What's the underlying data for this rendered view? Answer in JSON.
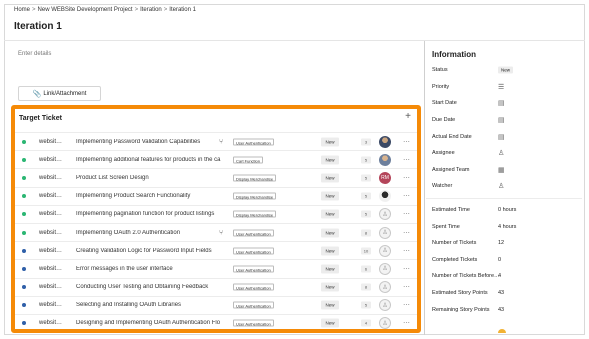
{
  "breadcrumb": [
    "Home",
    "New WEBSite Development Project",
    "Iteration",
    "Iteration 1"
  ],
  "breadcrumb_sep": ">",
  "page_title": "Iteration 1",
  "details_placeholder": "Enter details",
  "link_button_label": "Link/Attachment",
  "ticket_panel": {
    "title": "Target Ticket",
    "add_label": "+",
    "rows": [
      {
        "dot_color": "#2bb673",
        "project": "websit…",
        "title": "Implementing Password Validation Capabilities",
        "subtask": true,
        "tag": "User Authentication",
        "status": "New",
        "points": "3",
        "avatar": "photo1",
        "avatar_text": "",
        "more": "···"
      },
      {
        "dot_color": "#2bb673",
        "project": "websit…",
        "title": "Implementing additional features for products in the ca",
        "subtask": false,
        "tag": "Cart Function",
        "status": "New",
        "points": "5",
        "avatar": "photo2",
        "avatar_text": "",
        "more": "···"
      },
      {
        "dot_color": "#2bb673",
        "project": "websit…",
        "title": "Product List Screen Design",
        "subtask": false,
        "tag": "Display Merchandise",
        "status": "New",
        "points": "5",
        "avatar": "initials",
        "avatar_text": "RM",
        "more": "···"
      },
      {
        "dot_color": "#2bb673",
        "project": "websit…",
        "title": "Implementing Product Search Functionality",
        "subtask": false,
        "tag": "Display Merchandise",
        "status": "New",
        "points": "5",
        "avatar": "photo3",
        "avatar_text": "",
        "more": "···"
      },
      {
        "dot_color": "#2bb673",
        "project": "websit…",
        "title": "Implementing pagination function for product listings",
        "subtask": false,
        "tag": "Display Merchandise",
        "status": "New",
        "points": "5",
        "avatar": "empty",
        "avatar_text": "",
        "more": "···"
      },
      {
        "dot_color": "#2bb673",
        "project": "websit…",
        "title": "Implementing OAuth 2.0 Authentication",
        "subtask": true,
        "tag": "User Authentication",
        "status": "New",
        "points": "8",
        "avatar": "empty",
        "avatar_text": "",
        "more": "···"
      },
      {
        "dot_color": "#2f5fa8",
        "project": "websit…",
        "title": "Creating Validation Logic for Password Input Fields",
        "subtask": false,
        "tag": "User Authentication",
        "status": "New",
        "points": "10",
        "avatar": "empty",
        "avatar_text": "",
        "more": "···"
      },
      {
        "dot_color": "#2f5fa8",
        "project": "websit…",
        "title": "Error messages in the user interface",
        "subtask": false,
        "tag": "User Authentication",
        "status": "New",
        "points": "6",
        "avatar": "empty",
        "avatar_text": "",
        "more": "···"
      },
      {
        "dot_color": "#2f5fa8",
        "project": "websit…",
        "title": "Conducting User Testing and Obtaining Feedback",
        "subtask": false,
        "tag": "User Authentication",
        "status": "New",
        "points": "8",
        "avatar": "empty",
        "avatar_text": "",
        "more": "···"
      },
      {
        "dot_color": "#2f5fa8",
        "project": "websit…",
        "title": "Selecting and Installing OAuth Libraries",
        "subtask": false,
        "tag": "User Authentication",
        "status": "New",
        "points": "5",
        "avatar": "empty",
        "avatar_text": "",
        "more": "···"
      },
      {
        "dot_color": "#2f5fa8",
        "project": "websit…",
        "title": "Designing and Implementing OAuth Authentication Flo",
        "subtask": false,
        "tag": "User Authentication",
        "status": "New",
        "points": "4",
        "avatar": "empty",
        "avatar_text": "",
        "more": "···"
      }
    ]
  },
  "information": {
    "title": "Information",
    "fields_top": [
      {
        "label": "Status",
        "value": "New",
        "type": "badge"
      },
      {
        "label": "Priority",
        "value": "☰",
        "type": "icon",
        "icon": "priority-icon"
      },
      {
        "label": "Start Date",
        "value": "▤",
        "type": "icon",
        "icon": "calendar-icon"
      },
      {
        "label": "Due Date",
        "value": "▤",
        "type": "icon",
        "icon": "calendar-icon"
      },
      {
        "label": "Actual End Date",
        "value": "▤",
        "type": "icon",
        "icon": "calendar-icon"
      },
      {
        "label": "Assignee",
        "value": "♙",
        "type": "icon",
        "icon": "person-icon"
      },
      {
        "label": "Assigned Team",
        "value": "▦",
        "type": "icon",
        "icon": "team-icon"
      },
      {
        "label": "Watcher",
        "value": "♙",
        "type": "icon",
        "icon": "watcher-icon"
      }
    ],
    "fields_bottom": [
      {
        "label": "Estimated Time",
        "value": "0 hours"
      },
      {
        "label": "Spent Time",
        "value": "4 hours"
      },
      {
        "label": "Number of Tickets",
        "value": "12"
      },
      {
        "label": "Completed Tickets",
        "value": "0"
      },
      {
        "label": "Number of Tickets Before…",
        "value": "4"
      },
      {
        "label": "Estimated Story Points",
        "value": "43"
      },
      {
        "label": "Remaining Story Points",
        "value": "43"
      }
    ]
  },
  "colors": {
    "accent_border": "#f58a07",
    "done_dot": "#2bb673",
    "todo_dot": "#2f5fa8"
  }
}
